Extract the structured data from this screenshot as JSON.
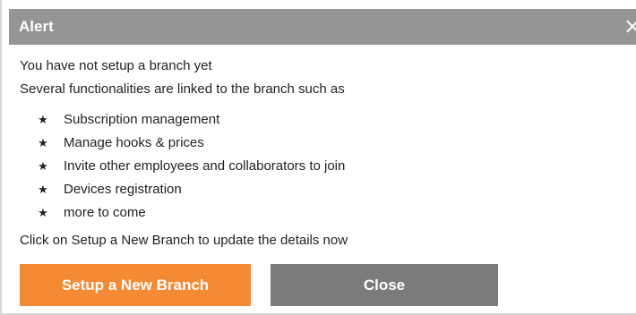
{
  "dialog": {
    "title": "Alert",
    "close_icon": "×",
    "message_line1": "You have not setup a branch yet",
    "message_line2": "Several functionalities are linked to the branch such as",
    "bullet_glyph": "★",
    "features": [
      "Subscription management",
      "Manage hooks & prices",
      "Invite other employees and collaborators to join",
      "Devices registration",
      "more to come"
    ],
    "message_line3": "Click on Setup a New Branch to update the details now",
    "buttons": {
      "setup_label": "Setup a New Branch",
      "close_label": "Close"
    },
    "colors": {
      "titlebar": "#959595",
      "setup_button": "#f58a34",
      "close_button": "#7b7b7b"
    }
  }
}
